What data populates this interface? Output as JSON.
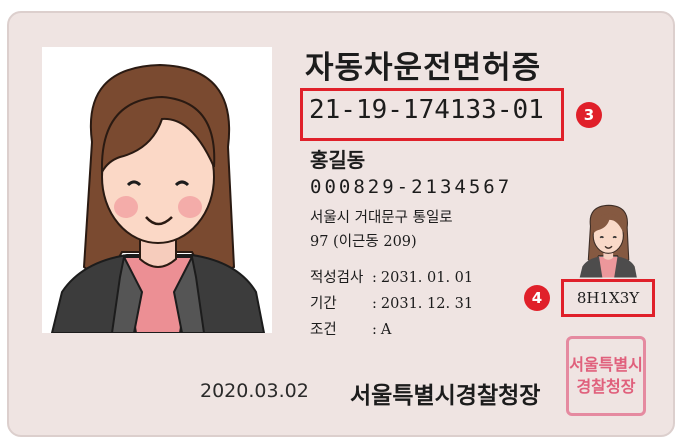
{
  "card": {
    "title": "자동차운전면허증",
    "license_number": "21-19-174133-01",
    "name": "홍길동",
    "resident_number": "000829-2134567",
    "address_line1": "서울시 거대문구 통일로",
    "address_line2": "97 (이근동 209)",
    "fields": [
      {
        "label": "적성검사",
        "value": "2031. 01. 01"
      },
      {
        "label": "기간",
        "value": "2031. 12. 31"
      },
      {
        "label": "조건",
        "value": "A"
      }
    ],
    "verification_code": "8H1X3Y",
    "issue_date": "2020.03.02",
    "issuing_authority": "서울특별시경찰청장",
    "seal_line1": "서울특별시",
    "seal_line2": "경찰청장"
  },
  "markers": {
    "license_number": "3",
    "verification_code": "4"
  },
  "colors": {
    "card_bg": "#efe4e2",
    "highlight": "#e0202a",
    "seal": "#e0607c"
  },
  "icons": {
    "photo": "portrait-woman-icon",
    "small_photo": "portrait-woman-icon",
    "seal": "official-seal-icon"
  }
}
